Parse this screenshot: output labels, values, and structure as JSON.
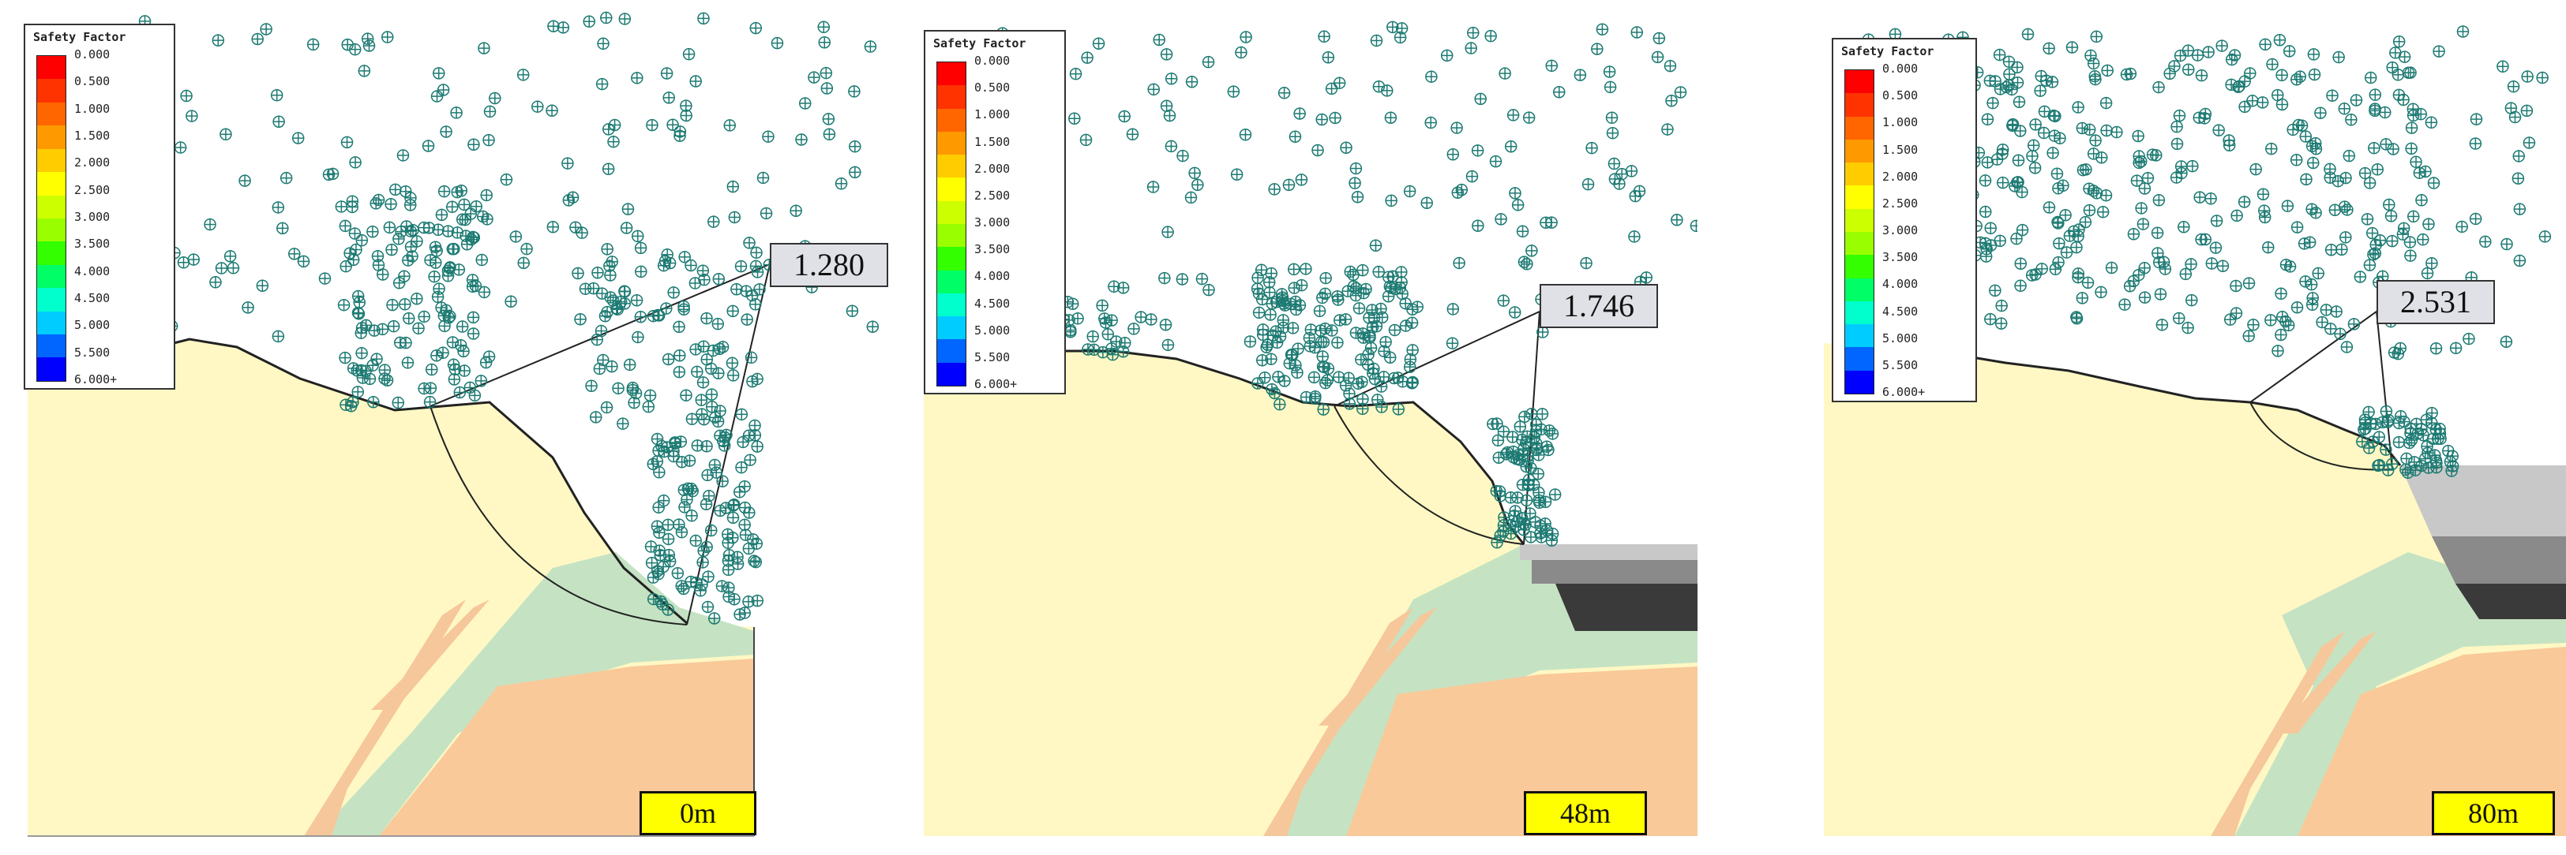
{
  "legend": {
    "title": "Safety Factor",
    "labels": [
      "0.000",
      "0.500",
      "1.000",
      "1.500",
      "2.000",
      "2.500",
      "3.000",
      "3.500",
      "4.000",
      "4.500",
      "5.000",
      "5.500",
      "6.000+"
    ],
    "colors": [
      "#ff0000",
      "#ff3300",
      "#ff6600",
      "#ff9900",
      "#ffcc00",
      "#ffff00",
      "#ccff00",
      "#99ff00",
      "#33ff00",
      "#00ff66",
      "#00ffcc",
      "#00ccff",
      "#0066ff",
      "#0000ff"
    ]
  },
  "panels": [
    {
      "id": "p1",
      "safety_factor": "1.280",
      "depth_label": "0m"
    },
    {
      "id": "p2",
      "safety_factor": "1.746",
      "depth_label": "48m"
    },
    {
      "id": "p3",
      "safety_factor": "2.531",
      "depth_label": "80m"
    }
  ],
  "colors": {
    "soil": "#fff8c4",
    "weathered": "#c5e3c3",
    "bedrock": "#f9c99a",
    "dyke": "#f6c79b",
    "markers": "#1c7a72",
    "excavation_light": "#c8c8c8",
    "excavation_mid": "#8a8a8a",
    "excavation_dark": "#3a3a3a",
    "depth_box": "#ffff00",
    "sf_box": "#dfe1e7"
  }
}
